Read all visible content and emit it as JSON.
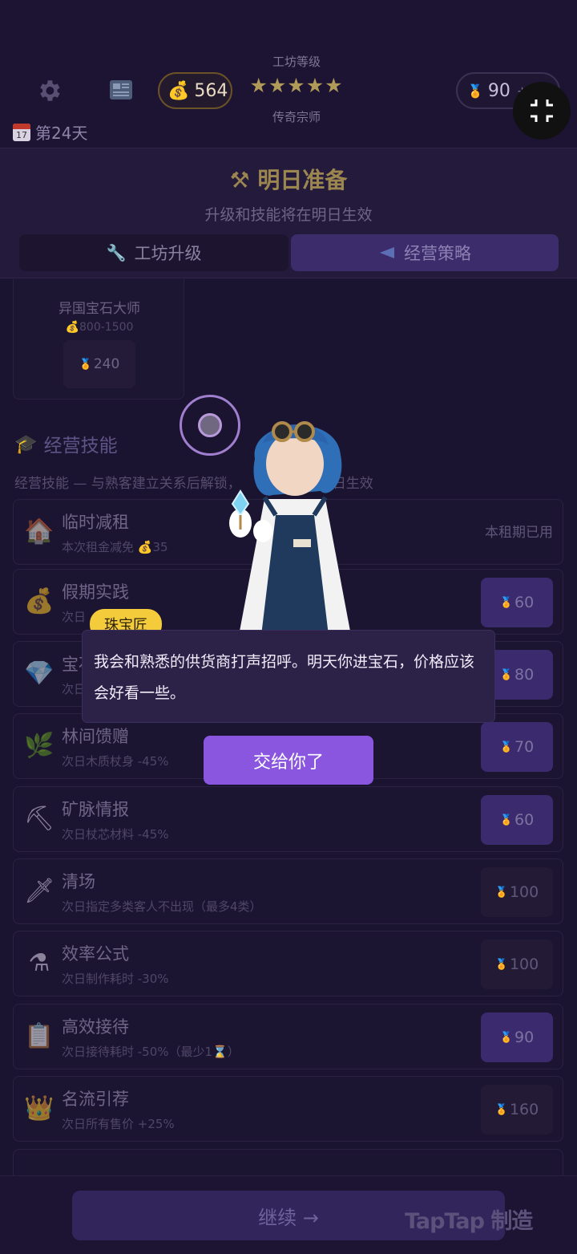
{
  "header": {
    "coins": "564",
    "workshop_level_label": "工坊等级",
    "stars": "★★★★★",
    "rank_name": "传奇宗师",
    "medals": "90",
    "medals_extra": "+2/5",
    "day": "第24天",
    "calendar_day": "17"
  },
  "panel": {
    "title": "明日准备",
    "subtitle": "升级和技能将在明日生效",
    "tabs": [
      {
        "label": "工坊升级",
        "icon": "wrench-icon"
      },
      {
        "label": "经营策略",
        "icon": "megaphone-icon"
      }
    ]
  },
  "gem_card": {
    "name": "异国宝石大师",
    "range": "800-1500",
    "price": "240"
  },
  "skills_section": {
    "title": "经营技能",
    "desc": "经营技能 — 与熟客建立关系后解锁，",
    "desc_tail": "日生效"
  },
  "skills": [
    {
      "name": "临时减租",
      "desc": "本次租金减免 💰35",
      "icon": "house-icon",
      "status": "本租期已用"
    },
    {
      "name": "假期实践",
      "desc": "次日",
      "icon": "money-bag-icon",
      "price": "60"
    },
    {
      "name": "宝石",
      "desc": "次日",
      "icon": "diamond-icon",
      "price": "80"
    },
    {
      "name": "林间馈赠",
      "desc": "次日木质杖身 -45%",
      "icon": "leaf-icon",
      "price": "70"
    },
    {
      "name": "矿脉情报",
      "desc": "次日杖芯材料 -45%",
      "icon": "pickaxe-icon",
      "price": "60"
    },
    {
      "name": "清场",
      "desc": "次日指定多类客人不出现（最多4类）",
      "icon": "dagger-icon",
      "price": "100"
    },
    {
      "name": "效率公式",
      "desc": "次日制作耗时 -30%",
      "icon": "cauldron-icon",
      "price": "100"
    },
    {
      "name": "高效接待",
      "desc": "次日接待耗时 -50%（最少1⌛）",
      "icon": "clipboard-icon",
      "price": "90"
    },
    {
      "name": "名流引荐",
      "desc": "次日所有售价 +25%",
      "icon": "crown-icon",
      "price": "160"
    }
  ],
  "footer": {
    "continue": "继续 →",
    "watermark": "TapTap 制造"
  },
  "dialog": {
    "speaker": "珠宝匠",
    "text": "我会和熟悉的供货商打声招呼。明天你进宝石，价格应该会好看一些。",
    "accept": "交给你了"
  },
  "colors": {
    "background": "#1b1430",
    "accent_purple": "#8a56e0",
    "speaker_tag": "#f4cc3b",
    "gold": "#b09a58"
  }
}
